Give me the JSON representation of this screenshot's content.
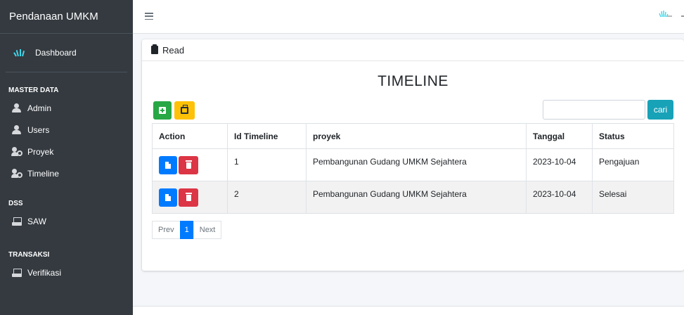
{
  "brand": "Pendanaan UMKM",
  "sidebar": {
    "dashboard": "Dashboard",
    "sections": [
      {
        "header": "MASTER DATA",
        "items": [
          {
            "label": "Admin",
            "icon": "user-icon"
          },
          {
            "label": "Users",
            "icon": "users-icon"
          },
          {
            "label": "Proyek",
            "icon": "users-cog-icon"
          },
          {
            "label": "Timeline",
            "icon": "users-cog-icon"
          }
        ]
      },
      {
        "header": "DSS",
        "items": [
          {
            "label": "SAW",
            "icon": "cash-register-icon"
          }
        ]
      },
      {
        "header": "TRANSAKSI",
        "items": [
          {
            "label": "Verifikasi",
            "icon": "cash-register-icon"
          }
        ]
      }
    ]
  },
  "card": {
    "header": "Read",
    "title": "TIMELINE",
    "search": {
      "value": "",
      "placeholder": "",
      "button": "cari"
    }
  },
  "table": {
    "columns": [
      "Action",
      "Id Timeline",
      "proyek",
      "Tanggal",
      "Status"
    ],
    "rows": [
      {
        "id": "1",
        "proyek": "Pembangunan Gudang UMKM Sejahtera",
        "tanggal": "2023-10-04",
        "status": "Pengajuan"
      },
      {
        "id": "2",
        "proyek": "Pembangunan Gudang UMKM Sejahtera",
        "tanggal": "2023-10-04",
        "status": "Selesai"
      }
    ]
  },
  "pagination": {
    "prev": "Prev",
    "current": "1",
    "next": "Next"
  },
  "colors": {
    "sidebar": "#343a40",
    "success": "#28a745",
    "warning": "#ffc107",
    "info": "#17a2b8",
    "primary": "#007bff",
    "danger": "#dc3545"
  }
}
